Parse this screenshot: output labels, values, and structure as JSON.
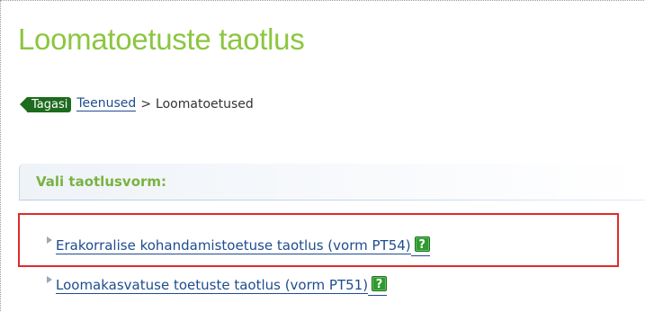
{
  "page": {
    "title": "Loomatoetuste taotlus"
  },
  "breadcrumb": {
    "back_label": "Tagasi",
    "link_label": "Teenused",
    "separator": ">",
    "current_label": "Loomatoetused"
  },
  "section": {
    "title": "Vali taotlusvorm:"
  },
  "forms": [
    {
      "label": "Erakorralise kohandamistoetuse taotlus (vorm PT54)",
      "help_icon": "help-icon",
      "help_glyph": "?",
      "highlighted": true
    },
    {
      "label": "Loomakasvatuse toetuste taotlus (vorm PT51)",
      "help_icon": "help-icon",
      "help_glyph": "?",
      "highlighted": false
    }
  ],
  "colors": {
    "title_green": "#8cc63f",
    "back_button_green": "#1d6b1d",
    "link_blue": "#1f4c8f",
    "highlight_red": "#e02a2a",
    "help_icon_green": "#2f9a2f"
  }
}
